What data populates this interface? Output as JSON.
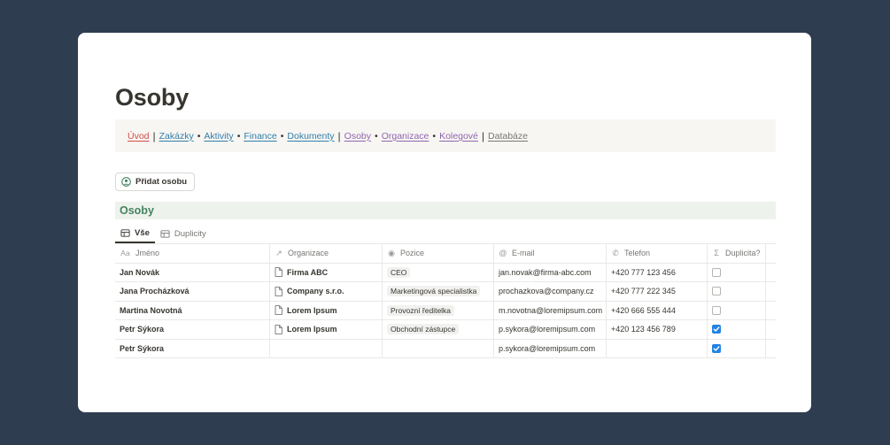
{
  "page": {
    "title": "Osoby"
  },
  "nav": [
    {
      "label": "Úvod",
      "color": "#d44c47",
      "sep_after": "|"
    },
    {
      "label": "Zakázky",
      "color": "#337ea9",
      "sep_after": "•"
    },
    {
      "label": "Aktivity",
      "color": "#337ea9",
      "sep_after": "•"
    },
    {
      "label": "Finance",
      "color": "#337ea9",
      "sep_after": "•"
    },
    {
      "label": "Dokumenty",
      "color": "#337ea9",
      "sep_after": "|"
    },
    {
      "label": "Osoby",
      "color": "#9065b0",
      "sep_after": "•"
    },
    {
      "label": "Organizace",
      "color": "#9065b0",
      "sep_after": "•"
    },
    {
      "label": "Kolegové",
      "color": "#9065b0",
      "sep_after": "|"
    },
    {
      "label": "Databáze",
      "color": "#787774",
      "sep_after": ""
    }
  ],
  "add_button": {
    "label": "Přidat osobu",
    "icon": "user-circle-icon"
  },
  "database": {
    "title": "Osoby",
    "title_color": "#448361",
    "views": [
      {
        "label": "Vše",
        "icon": "table-icon",
        "active": true
      },
      {
        "label": "Duplicity",
        "icon": "table-icon",
        "active": false
      }
    ],
    "columns": [
      {
        "label": "Jméno",
        "icon": "text-icon"
      },
      {
        "label": "Organizace",
        "icon": "relation-arrow-icon"
      },
      {
        "label": "Pozice",
        "icon": "select-icon"
      },
      {
        "label": "E-mail",
        "icon": "at-icon"
      },
      {
        "label": "Telefon",
        "icon": "phone-icon"
      },
      {
        "label": "Duplicita?",
        "icon": "sigma-icon"
      }
    ],
    "rows": [
      {
        "name": "Jan Novák",
        "org": "Firma ABC",
        "position": "CEO",
        "email": "jan.novak@firma-abc.com",
        "phone": "+420 777 123 456",
        "duplicate": false
      },
      {
        "name": "Jana Procházková",
        "org": "Company s.r.o.",
        "position": "Marketingová specialistka",
        "email": "prochazkova@company.cz",
        "phone": "+420 777 222 345",
        "duplicate": false
      },
      {
        "name": "Martina Novotná",
        "org": "Lorem Ipsum",
        "position": "Provozní ředitelka",
        "email": "m.novotna@loremipsum.com",
        "phone": "+420 666 555 444",
        "duplicate": false
      },
      {
        "name": "Petr Sýkora",
        "org": "Lorem Ipsum",
        "position": "Obchodní zástupce",
        "email": "p.sykora@loremipsum.com",
        "phone": "+420 123 456 789",
        "duplicate": true
      },
      {
        "name": "Petr Sýkora",
        "org": "",
        "position": "",
        "email": "p.sykora@loremipsum.com",
        "phone": "",
        "duplicate": true
      }
    ]
  }
}
